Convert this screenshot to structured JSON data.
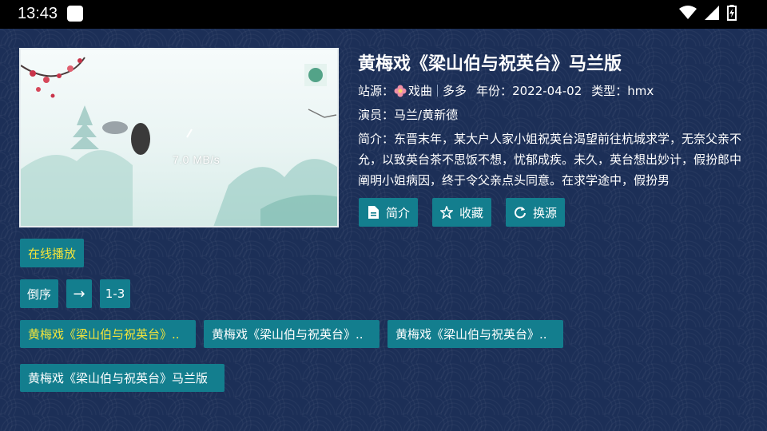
{
  "status": {
    "time": "13:43",
    "icons": [
      "wifi-icon",
      "signal-icon",
      "battery-charging-icon"
    ]
  },
  "video": {
    "speed": "7.0 MB/s"
  },
  "detail": {
    "title": "黄梅戏《梁山伯与祝英台》马兰版",
    "site_label": "站源：",
    "site_value": "戏曲",
    "site_sub": "多多",
    "year_label": "年份：",
    "year_value": "2022-04-02",
    "type_label": "类型：",
    "type_value": "hmx",
    "actors_label": "演员：",
    "actors_value": "马兰/黄新德",
    "intro_label": "简介：",
    "intro_value": "东晋末年，某大户人家小姐祝英台渴望前往杭城求学，无奈父亲不允，以致英台茶不思饭不想，忧郁成疾。未久，英台想出妙计，假扮郎中阐明小姐病因，终于令父亲点头同意。在求学途中，假扮男"
  },
  "actions": {
    "intro": "简介",
    "favorite": "收藏",
    "switch_source": "换源"
  },
  "play_section": {
    "label": "在线播放"
  },
  "controls": {
    "reverse": "倒序",
    "arrow": "→",
    "range": "1-3"
  },
  "episodes": [
    "黄梅戏《梁山伯与祝英台》..",
    "黄梅戏《梁山伯与祝英台》..",
    "黄梅戏《梁山伯与祝英台》.."
  ],
  "episode_full": "黄梅戏《梁山伯与祝英台》马兰版",
  "colors": {
    "accent": "#137e8e",
    "highlight": "#f4e43a",
    "background": "#1c2f57"
  }
}
